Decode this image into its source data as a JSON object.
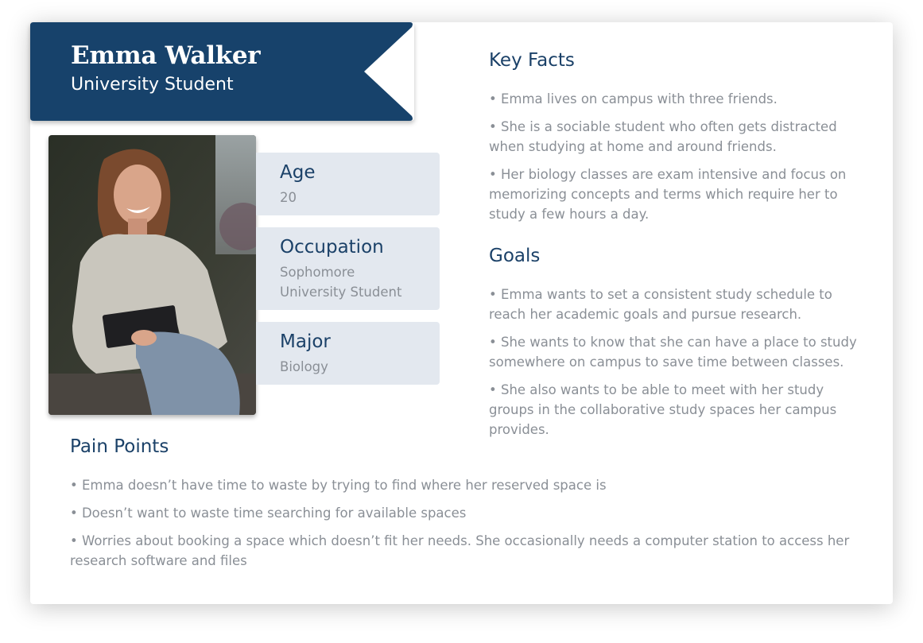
{
  "persona": {
    "name": "Emma Walker",
    "role": "University Student"
  },
  "photo": {
    "alt": "Emma Walker"
  },
  "info": [
    {
      "label": "Age",
      "value": "20"
    },
    {
      "label": "Occupation",
      "value": "Sophomore University Student"
    },
    {
      "label": "Major",
      "value": "Biology"
    }
  ],
  "key_facts": {
    "heading": "Key Facts",
    "items": [
      "• Emma lives on campus with three friends.",
      "• She is a sociable student who often gets distracted when studying at home and around friends.",
      "• Her biology classes are exam intensive and focus on memorizing concepts and terms which require her to study a few hours a day."
    ]
  },
  "goals": {
    "heading": "Goals",
    "items": [
      "• Emma wants to set a consistent study schedule to reach her academic goals and pursue research.",
      "• She wants to know that she can have a place to study somewhere on campus to save time between classes.",
      "• She also wants to be able to meet with her study groups in the collaborative study spaces her campus provides."
    ]
  },
  "pain_points": {
    "heading": "Pain Points",
    "items": [
      "• Emma doesn’t have time to waste by trying to find where her reserved space is",
      "• Doesn’t want to waste time searching for available spaces",
      "• Worries about booking a space which doesn’t fit her needs. She occasionally needs a computer station to access her research software and files"
    ]
  },
  "colors": {
    "banner": "#17426b",
    "heading": "#1b4168",
    "body_text": "#8a8f96",
    "info_box": "#e3e8ef"
  }
}
